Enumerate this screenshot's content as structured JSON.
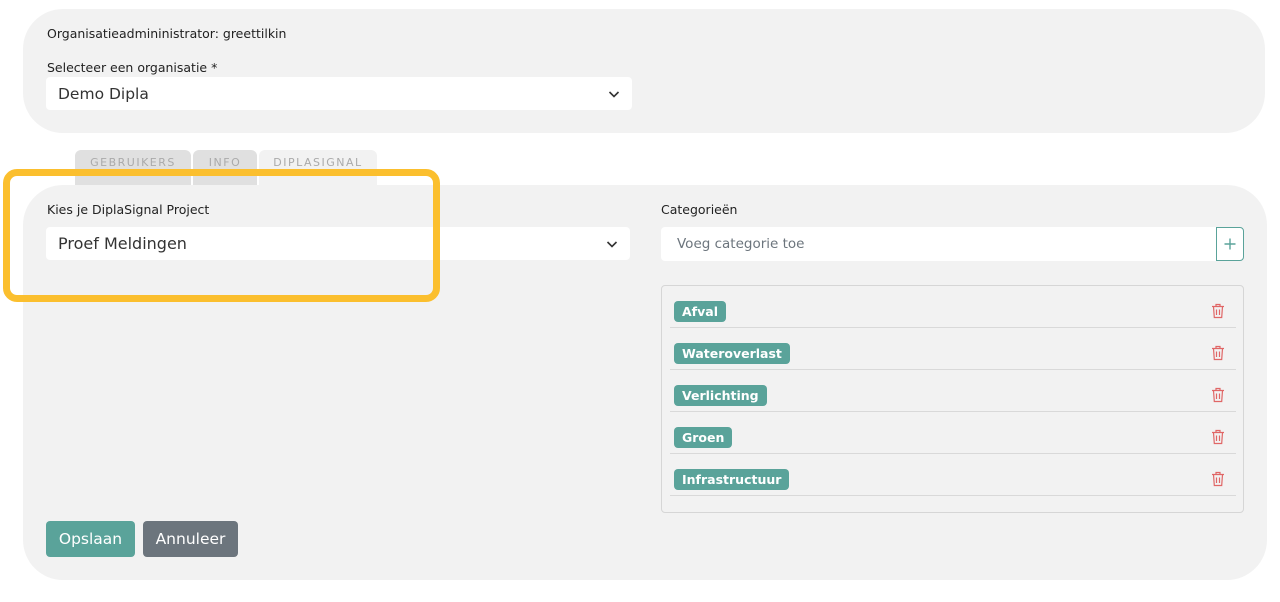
{
  "org": {
    "admin_label": "Organisatieadmininistrator: greettilkin",
    "select_label": "Selecteer een organisatie *",
    "selected": "Demo Dipla"
  },
  "tabs": [
    {
      "label": "GEBRUIKERS"
    },
    {
      "label": "INFO"
    },
    {
      "label": "DIPLASIGNAL"
    }
  ],
  "project": {
    "label": "Kies je DiplaSignal Project",
    "selected": "Proef Meldingen"
  },
  "categories": {
    "label": "Categorieën",
    "placeholder": "Voeg categorie toe",
    "items": [
      "Afval",
      "Wateroverlast",
      "Verlichting",
      "Groen",
      "Infrastructuur"
    ]
  },
  "buttons": {
    "save": "Opslaan",
    "cancel": "Annuleer"
  },
  "colors": {
    "accent": "#5aa39a",
    "secondary": "#6c757d",
    "delete": "#e06666",
    "highlight": "#fbbf2e",
    "panel": "#f2f2f2"
  }
}
